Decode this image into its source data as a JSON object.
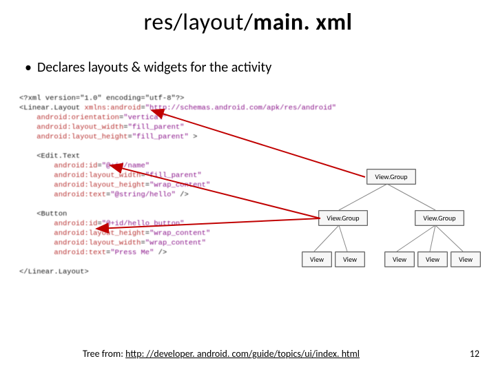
{
  "title": {
    "prefix": "res/layout/",
    "bold": "main. xml"
  },
  "bullet": "Declares layouts & widgets for the activity",
  "code": {
    "l1": "<?xml version=\"1.0\" encoding=\"utf-8\"?>",
    "l2a": "<Linear.Layout ",
    "l2b": "xmlns:android",
    "l2c": "=",
    "l2d": "\"http://schemas.android.com/apk/res/android\"",
    "l3a": "android:orientation",
    "l3b": "=",
    "l3c": "\"vertical\"",
    "l4a": "android:layout_width",
    "l4b": "=",
    "l4c": "\"fill_parent\"",
    "l5a": "android:layout_height",
    "l5b": "=",
    "l5c": "\"fill_parent\"",
    "l5d": " >",
    "l6": "<Edit.Text",
    "l7a": "android:id",
    "l7b": "=",
    "l7c": "\"@+id/name\"",
    "l8a": "android:layout_width",
    "l8b": "=",
    "l8c": "\"fill_parent\"",
    "l9a": "android:layout_height",
    "l9b": "=",
    "l9c": "\"wrap_content\"",
    "l10a": "android:text",
    "l10b": "=",
    "l10c": "\"@string/hello\"",
    "l10d": " />",
    "l11": "<Button",
    "l12a": "android:id",
    "l12b": "=",
    "l12c": "\"@+id/hello_button\"",
    "l13a": "android:layout_height",
    "l13b": "=",
    "l13c": "\"wrap_content\"",
    "l14a": "android:layout_width",
    "l14b": "=",
    "l14c": "\"wrap_content\"",
    "l15a": "android:text",
    "l15b": "=",
    "l15c": "\"Press Me\"",
    "l15d": " />",
    "l16": "</Linear.Layout>"
  },
  "tree": {
    "root": "View.Group",
    "mid1": "View.Group",
    "mid2": "View.Group",
    "leaf": "View"
  },
  "footer": {
    "label": "Tree from: ",
    "url": "http: //developer. android. com/guide/topics/ui/index. html"
  },
  "page": "12"
}
